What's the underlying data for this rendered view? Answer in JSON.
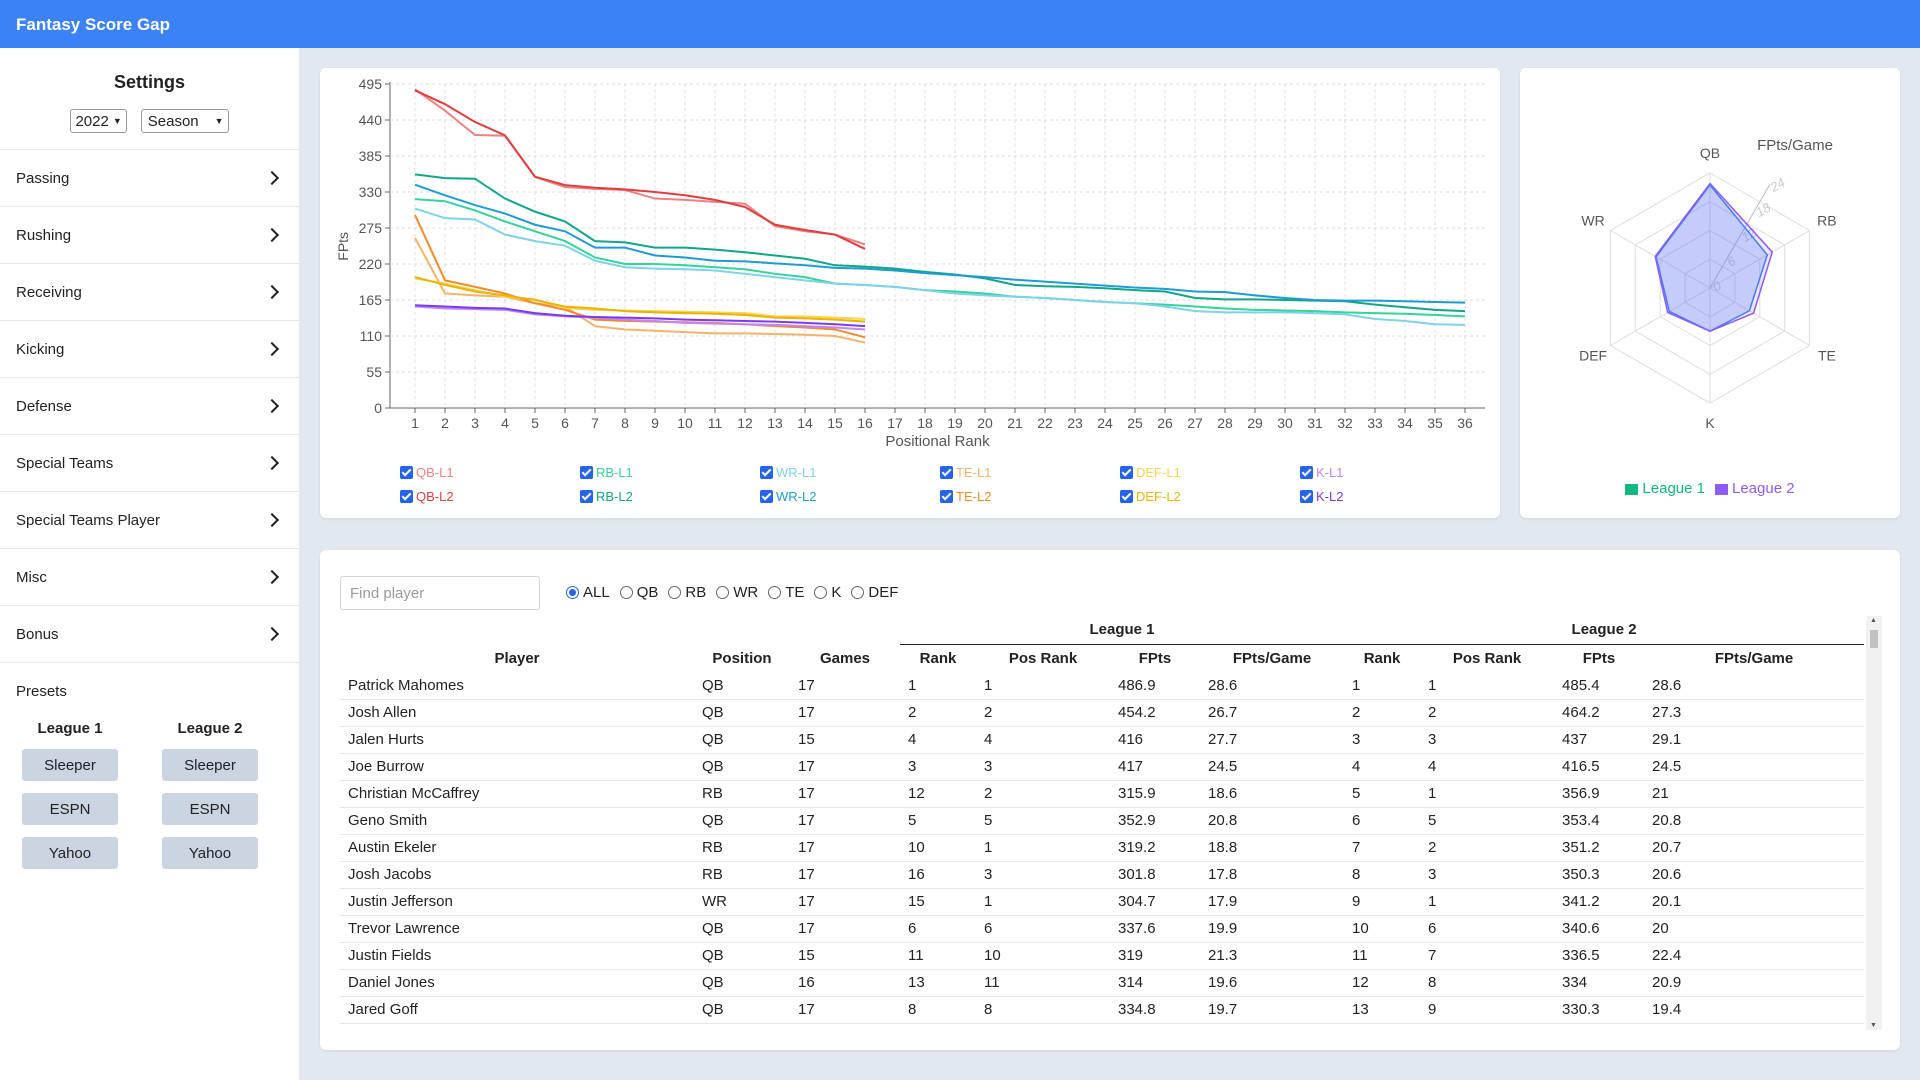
{
  "app": {
    "title": "Fantasy Score Gap"
  },
  "settings": {
    "title": "Settings",
    "year": "2022",
    "period": "Season",
    "categories": [
      "Passing",
      "Rushing",
      "Receiving",
      "Kicking",
      "Defense",
      "Special Teams",
      "Special Teams Player",
      "Misc",
      "Bonus"
    ]
  },
  "presets": {
    "title": "Presets",
    "leagues": [
      {
        "name": "League 1",
        "buttons": [
          "Sleeper",
          "ESPN",
          "Yahoo"
        ]
      },
      {
        "name": "League 2",
        "buttons": [
          "Sleeper",
          "ESPN",
          "Yahoo"
        ]
      }
    ]
  },
  "chart_data": [
    {
      "type": "line",
      "xlabel": "Positional Rank",
      "ylabel": "FPts",
      "ylim": [
        0,
        495
      ],
      "yticks": [
        0,
        55,
        110,
        165,
        220,
        275,
        330,
        385,
        440,
        495
      ],
      "x": [
        1,
        2,
        3,
        4,
        5,
        6,
        7,
        8,
        9,
        10,
        11,
        12,
        13,
        14,
        15,
        16,
        17,
        18,
        19,
        20,
        21,
        22,
        23,
        24,
        25,
        26,
        27,
        28,
        29,
        30,
        31,
        32,
        33,
        34,
        35,
        36
      ],
      "grid": true,
      "legend": "bottom",
      "series": [
        {
          "name": "QB-L1",
          "color": "#f08080",
          "values": [
            486.9,
            454.2,
            417,
            416,
            352.9,
            337.6,
            334.8,
            333,
            320,
            318,
            315,
            312,
            278,
            270,
            265,
            250
          ]
        },
        {
          "name": "QB-L2",
          "color": "#e03e3e",
          "values": [
            485.4,
            464.2,
            437,
            416.5,
            353.4,
            340.6,
            336.5,
            334,
            330,
            325,
            318,
            307,
            280,
            272,
            265,
            243
          ]
        },
        {
          "name": "RB-L1",
          "color": "#34d399",
          "values": [
            319.2,
            315.9,
            301.8,
            285,
            270,
            255,
            230,
            220,
            220,
            218,
            215,
            212,
            205,
            200,
            190,
            188,
            185,
            180,
            178,
            175,
            170,
            168,
            165,
            162,
            160,
            158,
            155,
            152,
            150,
            149,
            148,
            146,
            145,
            144,
            142,
            140
          ]
        },
        {
          "name": "RB-L2",
          "color": "#0fa68a",
          "values": [
            356.9,
            351.2,
            350.3,
            320,
            300,
            285,
            255,
            253,
            245,
            245,
            242,
            238,
            233,
            228,
            218,
            216,
            213,
            208,
            204,
            198,
            188,
            186,
            185,
            183,
            180,
            178,
            168,
            166,
            166,
            165,
            164,
            163,
            158,
            154,
            150,
            148
          ]
        },
        {
          "name": "WR-L1",
          "color": "#7dd3e8",
          "values": [
            304.7,
            290,
            288,
            265,
            255,
            248,
            225,
            215,
            213,
            212,
            210,
            205,
            200,
            195,
            190,
            188,
            185,
            180,
            175,
            172,
            170,
            168,
            165,
            162,
            160,
            155,
            148,
            146,
            146,
            146,
            145,
            143,
            136,
            133,
            128,
            127
          ]
        },
        {
          "name": "WR-L2",
          "color": "#1e9bd7",
          "values": [
            341.2,
            325,
            310,
            297,
            280,
            270,
            245,
            245,
            233,
            230,
            225,
            224,
            221,
            218,
            214,
            213,
            210,
            206,
            203,
            200,
            196,
            193,
            190,
            187,
            184,
            182,
            178,
            177,
            172,
            168,
            165,
            164,
            164,
            163,
            162,
            161
          ]
        },
        {
          "name": "TE-L1",
          "color": "#f7b267",
          "values": [
            260,
            175,
            172,
            170,
            160,
            155,
            125,
            120,
            118,
            116,
            114,
            114,
            113,
            112,
            110,
            100
          ]
        },
        {
          "name": "TE-L2",
          "color": "#f08c28",
          "values": [
            295,
            195,
            185,
            175,
            160,
            150,
            135,
            133,
            132,
            131,
            130,
            128,
            125,
            123,
            120,
            108
          ]
        },
        {
          "name": "DEF-L1",
          "color": "#fcd34d",
          "values": [
            198,
            190,
            180,
            170,
            166,
            153,
            150,
            149,
            148,
            147,
            146,
            145,
            140,
            140,
            138,
            136
          ]
        },
        {
          "name": "DEF-L2",
          "color": "#eab308",
          "values": [
            200,
            188,
            178,
            172,
            165,
            155,
            152,
            148,
            146,
            145,
            144,
            142,
            138,
            137,
            135,
            132
          ]
        },
        {
          "name": "K-L1",
          "color": "#c084fc",
          "values": [
            155,
            152,
            151,
            150,
            143,
            140,
            138,
            135,
            133,
            130,
            129,
            128,
            127,
            125,
            123,
            120
          ]
        },
        {
          "name": "K-L2",
          "color": "#7c3aed",
          "values": [
            157,
            155,
            153,
            152,
            145,
            141,
            139,
            138,
            137,
            135,
            134,
            133,
            132,
            130,
            128,
            125
          ]
        }
      ]
    },
    {
      "type": "radar",
      "axes": [
        "QB",
        "RB",
        "TE",
        "K",
        "DEF",
        "WR"
      ],
      "rlabel": "FPts/Game",
      "rticks": [
        0,
        6,
        12,
        18,
        24
      ],
      "rlim": [
        0,
        24
      ],
      "legend": "bottom",
      "series": [
        {
          "name": "League 1",
          "color": "#10b981",
          "values": [
            21.5,
            13.8,
            9.5,
            9.0,
            9.8,
            13.0
          ]
        },
        {
          "name": "League 2",
          "color": "#8b5cf6",
          "values": [
            21.8,
            15.0,
            10.5,
            9.0,
            10.2,
            13.2
          ]
        }
      ]
    }
  ],
  "filter": {
    "placeholder": "Find player",
    "positions": [
      "ALL",
      "QB",
      "RB",
      "WR",
      "TE",
      "K",
      "DEF"
    ],
    "selected": "ALL"
  },
  "table": {
    "group_headers": [
      "League 1",
      "League 2"
    ],
    "columns": [
      "Player",
      "Position",
      "Games",
      "Rank",
      "Pos Rank",
      "FPts",
      "FPts/Game",
      "Rank",
      "Pos Rank",
      "FPts",
      "FPts/Game"
    ],
    "rows": [
      [
        "Patrick Mahomes",
        "QB",
        "17",
        "1",
        "1",
        "486.9",
        "28.6",
        "1",
        "1",
        "485.4",
        "28.6"
      ],
      [
        "Josh Allen",
        "QB",
        "17",
        "2",
        "2",
        "454.2",
        "26.7",
        "2",
        "2",
        "464.2",
        "27.3"
      ],
      [
        "Jalen Hurts",
        "QB",
        "15",
        "4",
        "4",
        "416",
        "27.7",
        "3",
        "3",
        "437",
        "29.1"
      ],
      [
        "Joe Burrow",
        "QB",
        "17",
        "3",
        "3",
        "417",
        "24.5",
        "4",
        "4",
        "416.5",
        "24.5"
      ],
      [
        "Christian McCaffrey",
        "RB",
        "17",
        "12",
        "2",
        "315.9",
        "18.6",
        "5",
        "1",
        "356.9",
        "21"
      ],
      [
        "Geno Smith",
        "QB",
        "17",
        "5",
        "5",
        "352.9",
        "20.8",
        "6",
        "5",
        "353.4",
        "20.8"
      ],
      [
        "Austin Ekeler",
        "RB",
        "17",
        "10",
        "1",
        "319.2",
        "18.8",
        "7",
        "2",
        "351.2",
        "20.7"
      ],
      [
        "Josh Jacobs",
        "RB",
        "17",
        "16",
        "3",
        "301.8",
        "17.8",
        "8",
        "3",
        "350.3",
        "20.6"
      ],
      [
        "Justin Jefferson",
        "WR",
        "17",
        "15",
        "1",
        "304.7",
        "17.9",
        "9",
        "1",
        "341.2",
        "20.1"
      ],
      [
        "Trevor Lawrence",
        "QB",
        "17",
        "6",
        "6",
        "337.6",
        "19.9",
        "10",
        "6",
        "340.6",
        "20"
      ],
      [
        "Justin Fields",
        "QB",
        "15",
        "11",
        "10",
        "319",
        "21.3",
        "11",
        "7",
        "336.5",
        "22.4"
      ],
      [
        "Daniel Jones",
        "QB",
        "16",
        "13",
        "11",
        "314",
        "19.6",
        "12",
        "8",
        "334",
        "20.9"
      ],
      [
        "Jared Goff",
        "QB",
        "17",
        "8",
        "8",
        "334.8",
        "19.7",
        "13",
        "9",
        "330.3",
        "19.4"
      ]
    ]
  }
}
